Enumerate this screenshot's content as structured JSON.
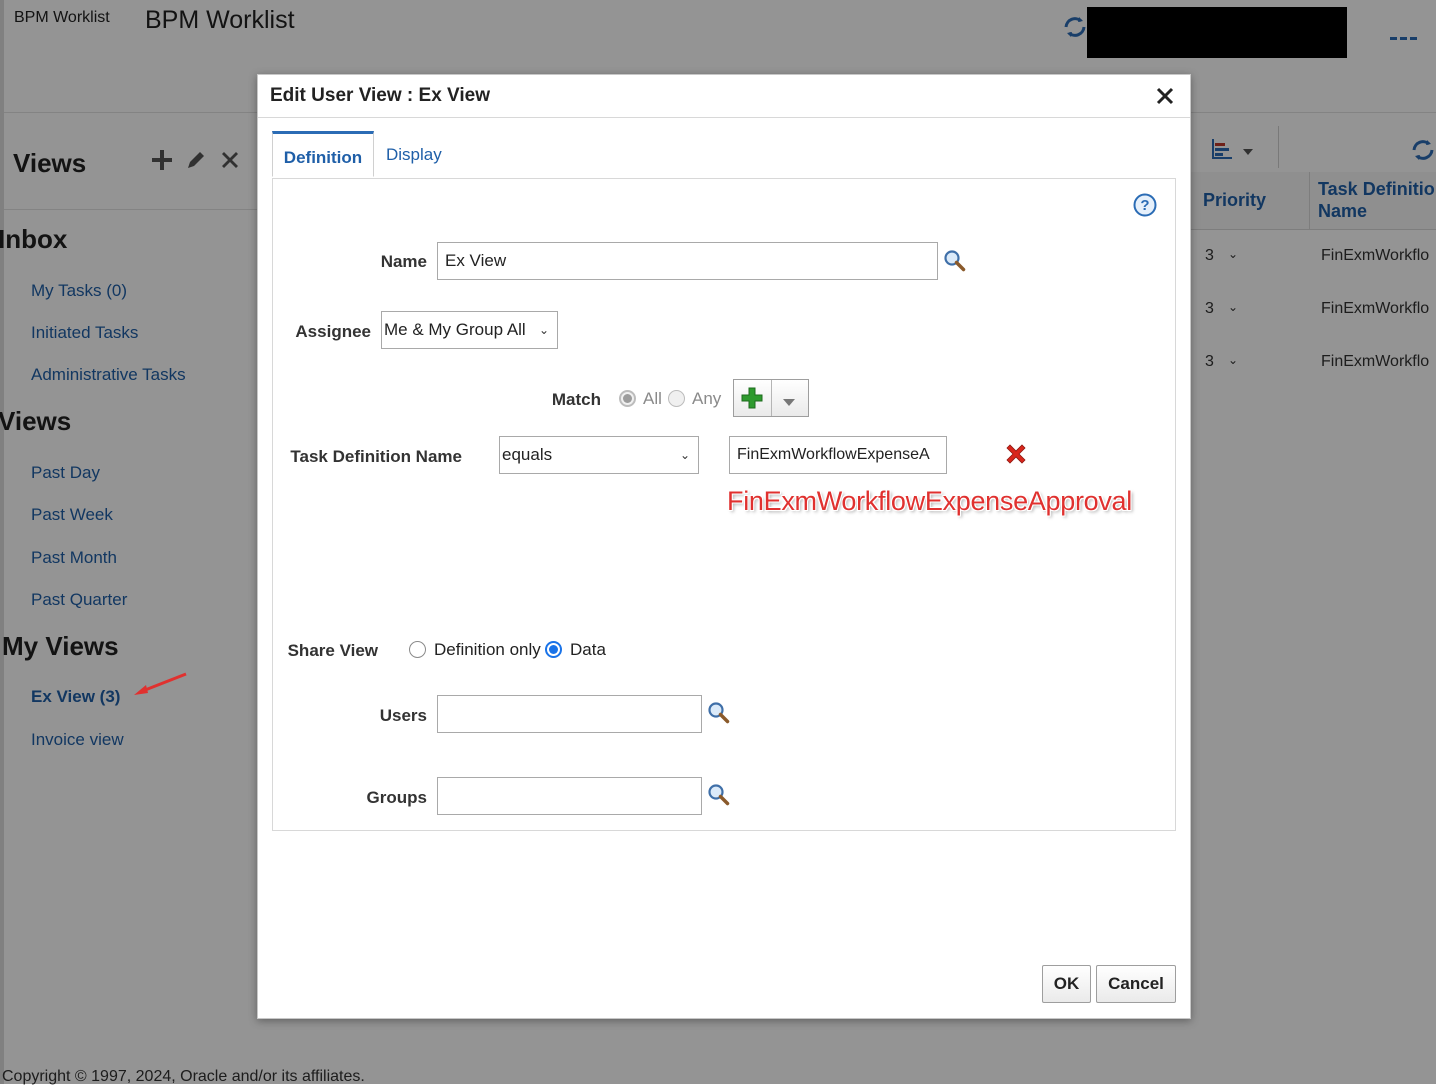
{
  "app": {
    "brand": "BPM Worklist",
    "title": "BPM Worklist"
  },
  "sidebar": {
    "header": "Views",
    "sections": [
      {
        "title": "Inbox",
        "items": [
          {
            "label": "My Tasks (0)"
          },
          {
            "label": "Initiated Tasks"
          },
          {
            "label": "Administrative Tasks"
          }
        ]
      },
      {
        "title": "Views",
        "items": [
          {
            "label": "Past Day"
          },
          {
            "label": "Past Week"
          },
          {
            "label": "Past Month"
          },
          {
            "label": "Past Quarter"
          }
        ]
      },
      {
        "title": "My Views",
        "items": [
          {
            "label": "Ex View (3)"
          },
          {
            "label": "Invoice view"
          }
        ]
      }
    ]
  },
  "table": {
    "columns": {
      "priority": "Priority",
      "task_definition_name": "Task Definitio Name"
    },
    "rows": [
      {
        "priority": "3",
        "task_definition_name": "FinExmWorkflo"
      },
      {
        "priority": "3",
        "task_definition_name": "FinExmWorkflo"
      },
      {
        "priority": "3",
        "task_definition_name": "FinExmWorkflo"
      }
    ]
  },
  "footer": {
    "copyright": "Copyright © 1997, 2024, Oracle and/or its affiliates."
  },
  "dialog": {
    "title": "Edit User View : Ex View",
    "tabs": [
      "Definition",
      "Display"
    ],
    "name_label": "Name",
    "name_value": "Ex View",
    "assignee_label": "Assignee",
    "assignee_value": "Me & My Group All",
    "match_label": "Match",
    "match_all": "All",
    "match_any": "Any",
    "condition_field_label": "Task Definition Name",
    "condition_operator": "equals",
    "condition_value": "FinExmWorkflowExpenseA",
    "annotation": "FinExmWorkflowExpenseApproval",
    "share_view_label": "Share View",
    "share_definition_only": "Definition only",
    "share_data": "Data",
    "users_label": "Users",
    "groups_label": "Groups",
    "ok_label": "OK",
    "cancel_label": "Cancel"
  },
  "colors": {
    "link": "#1f5fa8",
    "radio_selected": "#1a73e8",
    "annotation": "#e0312f",
    "add_icon": "#2e9a2e",
    "delete_icon": "#d9261c"
  }
}
